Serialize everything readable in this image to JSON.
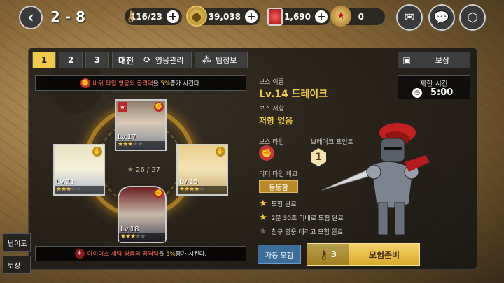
{
  "topbar": {
    "stage": "2 - 8",
    "resources": {
      "keys": "116/23",
      "gold": "39,038",
      "gems": "1,690",
      "medals": "0"
    }
  },
  "tabs": [
    "1",
    "2",
    "3",
    "대전"
  ],
  "hero_management_label": "영웅관리",
  "team_info_label": "팀정보",
  "reward_label": "보상",
  "formation": {
    "buff_top": {
      "pre": "바위 타입 영웅의 ",
      "stat": "공격력",
      "mid": "을 ",
      "pct": "5%",
      "post": "증가 시킨다."
    },
    "buff_bottom": {
      "pre": "마이어스 세력 영웅의 ",
      "stat": "공격력",
      "mid": "을 ",
      "pct": "5%",
      "post": "증가 시킨다."
    },
    "slot_count": "26 / 27",
    "heroes": [
      {
        "level": "Lv.17",
        "stars": 3
      },
      {
        "level": "Lv.21",
        "stars": 3
      },
      {
        "level": "Lv.15",
        "stars": 4
      },
      {
        "level": "Lv.18",
        "stars": 3
      }
    ]
  },
  "boss": {
    "name_label": "보스 이름",
    "name": "Lv.14 드레이크",
    "resist_label": "보스 저항",
    "resist": "저항 없음",
    "type_label": "보스 타입",
    "break_label": "브레이크 포인트",
    "break_value": "1",
    "leader_compare_label": "리더 타입 비교",
    "leader_compare_value": "동등함",
    "time_limit_label": "제한 시간",
    "time_limit": "5:00",
    "missions": [
      {
        "text": "모험 완료",
        "done": true
      },
      {
        "text": "2분 30초 이내로 모험 완료",
        "done": true
      },
      {
        "text": "친구 영웅 데리고 모험 완료",
        "done": false
      }
    ]
  },
  "buttons": {
    "auto": "자동 모험",
    "ready_cost": "3",
    "ready": "모험준비"
  },
  "edge_tabs": [
    "난이도",
    "보상"
  ],
  "colors": {
    "accent": "#f1c94c",
    "red": "#ff6a5a",
    "auto": "#3d6e99"
  }
}
